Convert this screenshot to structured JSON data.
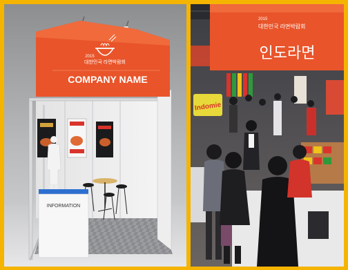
{
  "left_panel": {
    "signboard_year": "2015",
    "signboard_event": "대한민국 라면박람회",
    "company_name": "COMPANY NAME",
    "counter_label": "INFORMATION"
  },
  "right_panel": {
    "banner_year": "2015",
    "banner_event": "대한민국 라면박람회",
    "banner_brand": "인도라면",
    "side_sign": "Indomie"
  },
  "colors": {
    "frame_border": "#f5b400",
    "sign_orange": "#e9542a",
    "counter_blue": "#2d6fd0"
  }
}
